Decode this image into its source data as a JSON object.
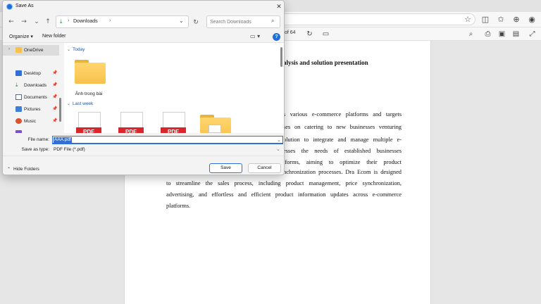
{
  "dialog": {
    "title": "Save As",
    "nav": {
      "path_segment": "Downloads",
      "search_placeholder": "Search Downloads"
    },
    "command_bar": {
      "organize_label": "Organize ▾",
      "new_folder_label": "New folder"
    },
    "sidebar": {
      "onedrive": "OneDrive",
      "items": [
        {
          "label": "Desktop",
          "icon": "desktop-icon",
          "color": "#2f6fd6"
        },
        {
          "label": "Downloads",
          "icon": "downloads-icon",
          "color": "#2a8a3c"
        },
        {
          "label": "Documents",
          "icon": "documents-icon",
          "color": "#5a6b7d"
        },
        {
          "label": "Pictures",
          "icon": "pictures-icon",
          "color": "#3d7fd9"
        },
        {
          "label": "Music",
          "icon": "music-icon",
          "color": "#d9532f"
        }
      ]
    },
    "groups": {
      "today": "Today",
      "last_week": "Last week"
    },
    "files": {
      "today_folder_label": "Ảnh trong bài",
      "pdf_badge": "PDF"
    },
    "fields": {
      "file_name_label": "File name:",
      "file_name_value": "AAA.pdf",
      "save_type_label": "Save as type:",
      "save_type_value": "PDF File (*.pdf)"
    },
    "footer": {
      "hide_folders_label": "Hide Folders",
      "save_label": "Save",
      "cancel_label": "Cancel"
    }
  },
  "viewer": {
    "page_count": "of 64",
    "heading": "alysis and solution presentation",
    "lines": [
      "s various e-commerce platforms and targets",
      "ses on catering to new businesses venturing",
      "olution to integrate and manage multiple e-",
      "esses the needs of established businesses",
      "tforms, aiming to optimize their product",
      "nchronization processes. Dra Ecom is designed",
      "to streamline the sales process, including product management, price synchronization,",
      "advertising, and effortless and efficient product information updates across e-commerce",
      "platforms."
    ]
  },
  "colors": {
    "accent": "#2f6fd6",
    "folder": "#f7c14c",
    "pdf_red": "#d9262c"
  }
}
